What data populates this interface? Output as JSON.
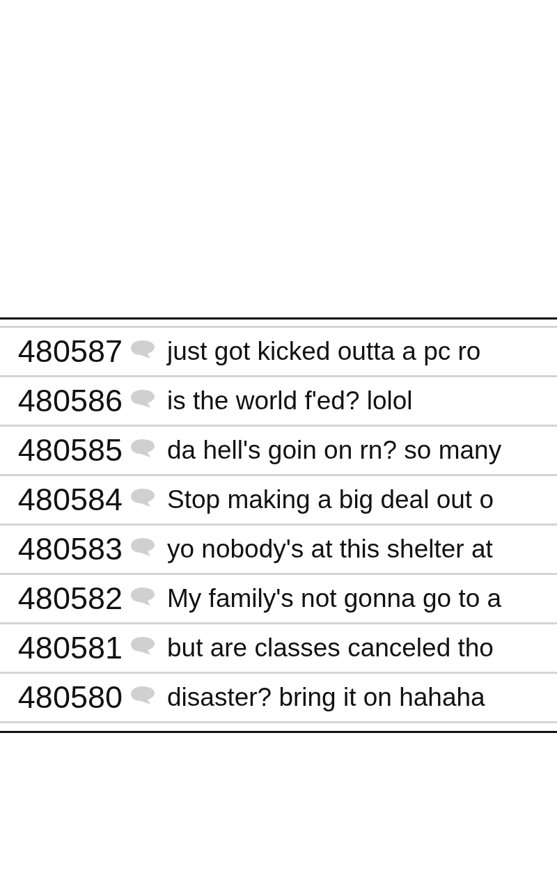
{
  "posts": [
    {
      "number": "480587",
      "title": "just got kicked outta a pc ro"
    },
    {
      "number": "480586",
      "title": "is the world f'ed? lolol"
    },
    {
      "number": "480585",
      "title": "da hell's goin on rn? so many"
    },
    {
      "number": "480584",
      "title": "Stop making a big deal out o"
    },
    {
      "number": "480583",
      "title": "yo nobody's at this shelter at"
    },
    {
      "number": "480582",
      "title": "My family's not gonna go to a"
    },
    {
      "number": "480581",
      "title": "but are classes canceled tho"
    },
    {
      "number": "480580",
      "title": "disaster? bring it on hahaha"
    }
  ]
}
